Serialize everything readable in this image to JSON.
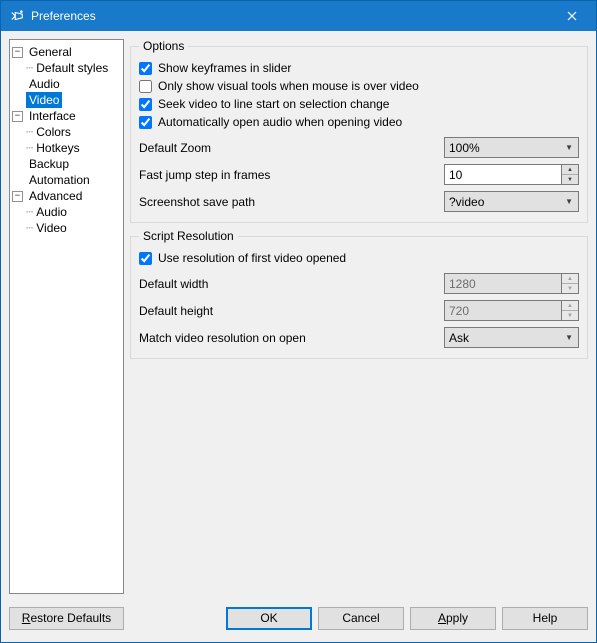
{
  "window": {
    "title": "Preferences"
  },
  "tree": {
    "general": "General",
    "default_styles": "Default styles",
    "audio": "Audio",
    "video": "Video",
    "interface": "Interface",
    "colors": "Colors",
    "hotkeys": "Hotkeys",
    "backup": "Backup",
    "automation": "Automation",
    "advanced": "Advanced",
    "adv_audio": "Audio",
    "adv_video": "Video"
  },
  "options": {
    "legend": "Options",
    "show_keyframes": "Show keyframes in slider",
    "only_visual": "Only show visual tools when mouse is over video",
    "seek_video": "Seek video to line start on selection change",
    "auto_open_audio": "Automatically open audio when opening video",
    "default_zoom_label": "Default Zoom",
    "default_zoom_value": "100%",
    "fast_jump_label": "Fast jump step in frames",
    "fast_jump_value": "10",
    "screenshot_label": "Screenshot save path",
    "screenshot_value": "?video"
  },
  "script_res": {
    "legend": "Script Resolution",
    "use_first": "Use resolution of first video opened",
    "default_width_label": "Default width",
    "default_width_value": "1280",
    "default_height_label": "Default height",
    "default_height_value": "720",
    "match_label": "Match video resolution on open",
    "match_value": "Ask"
  },
  "footer": {
    "restore": "Restore Defaults",
    "ok": "OK",
    "cancel": "Cancel",
    "apply": "Apply",
    "help": "Help"
  }
}
